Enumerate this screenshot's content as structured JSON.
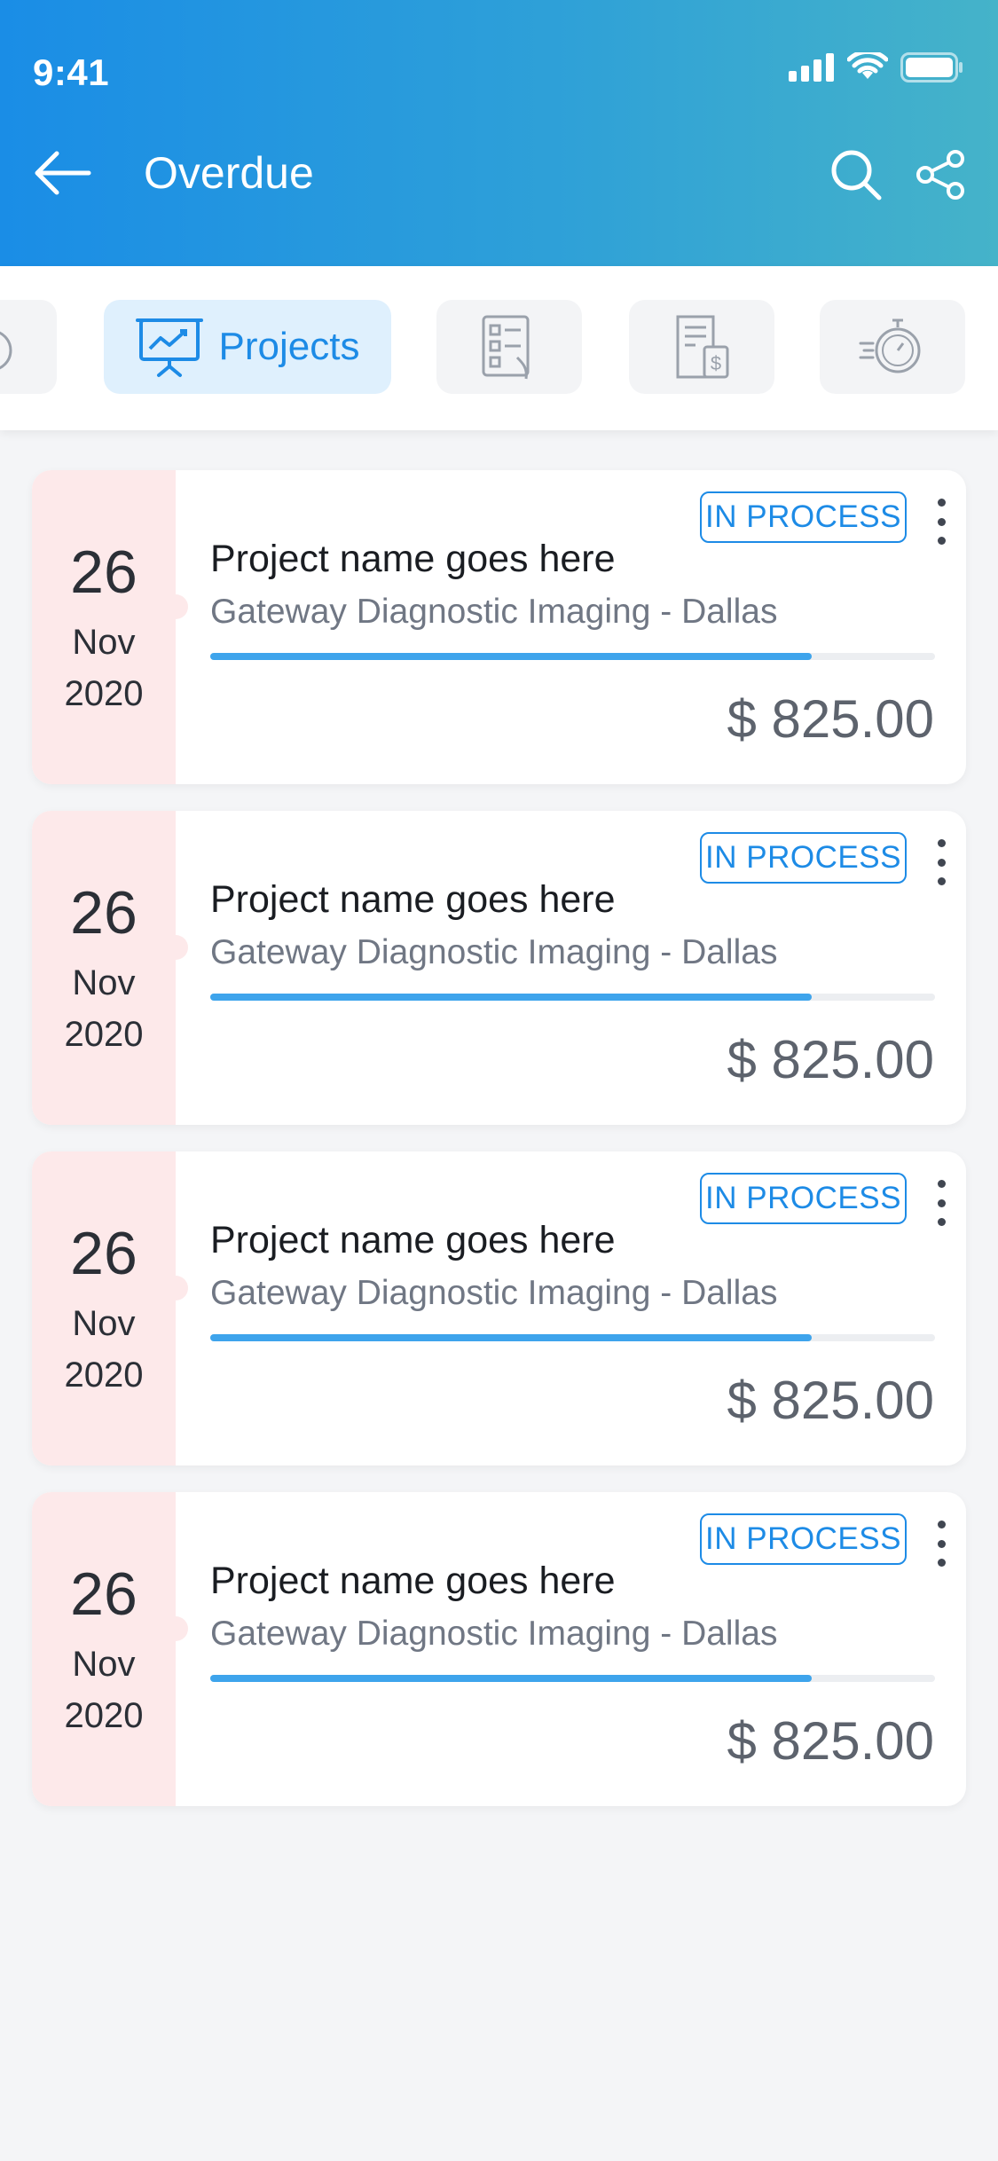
{
  "status_bar": {
    "time": "9:41"
  },
  "header": {
    "title": "Overdue"
  },
  "tabs": [
    {
      "icon": "stopwatch-icon",
      "label": ""
    },
    {
      "icon": "presentation-chart-icon",
      "label": "Projects",
      "active": true
    },
    {
      "icon": "checklist-document-icon",
      "label": ""
    },
    {
      "icon": "invoice-dollar-icon",
      "label": ""
    },
    {
      "icon": "fast-stopwatch-icon",
      "label": ""
    }
  ],
  "projects": [
    {
      "day": "26",
      "month": "Nov",
      "year": "2020",
      "status": "IN PROCESS",
      "name": "Project name goes here",
      "client": "Gateway Diagnostic Imaging - Dallas",
      "progress": 0.83,
      "amount": "$ 825.00"
    },
    {
      "day": "26",
      "month": "Nov",
      "year": "2020",
      "status": "IN PROCESS",
      "name": "Project name goes here",
      "client": "Gateway Diagnostic Imaging - Dallas",
      "progress": 0.83,
      "amount": "$ 825.00"
    },
    {
      "day": "26",
      "month": "Nov",
      "year": "2020",
      "status": "IN PROCESS",
      "name": "Project name goes here",
      "client": "Gateway Diagnostic Imaging - Dallas",
      "progress": 0.83,
      "amount": "$ 825.00"
    },
    {
      "day": "26",
      "month": "Nov",
      "year": "2020",
      "status": "IN PROCESS",
      "name": "Project name goes here",
      "client": "Gateway Diagnostic Imaging - Dallas",
      "progress": 0.83,
      "amount": "$ 825.00"
    }
  ],
  "colors": {
    "header_gradient_start": "#1a8de6",
    "header_gradient_end": "#45b3c9",
    "accent": "#1d8be6",
    "date_bg": "#fde9ea",
    "progress": "#3ea4ec"
  }
}
